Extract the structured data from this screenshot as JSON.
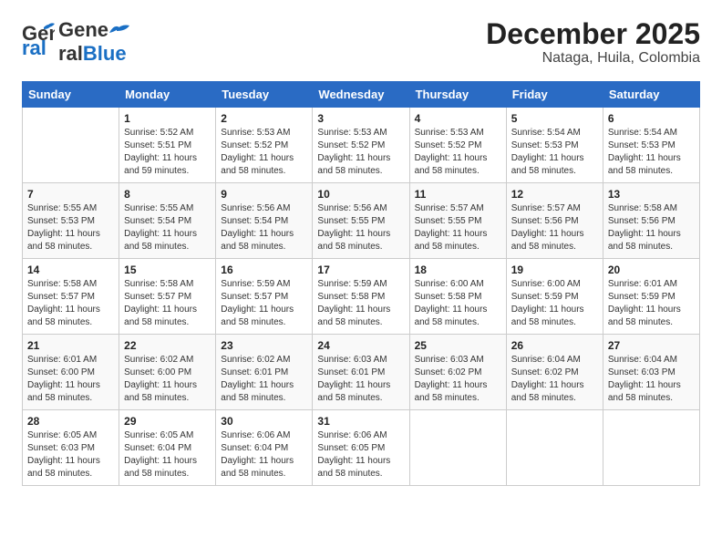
{
  "header": {
    "logo_general": "General",
    "logo_blue": "Blue",
    "title": "December 2025",
    "subtitle": "Nataga, Huila, Colombia"
  },
  "days_of_week": [
    "Sunday",
    "Monday",
    "Tuesday",
    "Wednesday",
    "Thursday",
    "Friday",
    "Saturday"
  ],
  "weeks": [
    [
      {
        "day": "",
        "sunrise": "",
        "sunset": "",
        "daylight": ""
      },
      {
        "day": "1",
        "sunrise": "Sunrise: 5:52 AM",
        "sunset": "Sunset: 5:51 PM",
        "daylight": "Daylight: 11 hours and 59 minutes."
      },
      {
        "day": "2",
        "sunrise": "Sunrise: 5:53 AM",
        "sunset": "Sunset: 5:52 PM",
        "daylight": "Daylight: 11 hours and 58 minutes."
      },
      {
        "day": "3",
        "sunrise": "Sunrise: 5:53 AM",
        "sunset": "Sunset: 5:52 PM",
        "daylight": "Daylight: 11 hours and 58 minutes."
      },
      {
        "day": "4",
        "sunrise": "Sunrise: 5:53 AM",
        "sunset": "Sunset: 5:52 PM",
        "daylight": "Daylight: 11 hours and 58 minutes."
      },
      {
        "day": "5",
        "sunrise": "Sunrise: 5:54 AM",
        "sunset": "Sunset: 5:53 PM",
        "daylight": "Daylight: 11 hours and 58 minutes."
      },
      {
        "day": "6",
        "sunrise": "Sunrise: 5:54 AM",
        "sunset": "Sunset: 5:53 PM",
        "daylight": "Daylight: 11 hours and 58 minutes."
      }
    ],
    [
      {
        "day": "7",
        "sunrise": "Sunrise: 5:55 AM",
        "sunset": "Sunset: 5:53 PM",
        "daylight": "Daylight: 11 hours and 58 minutes."
      },
      {
        "day": "8",
        "sunrise": "Sunrise: 5:55 AM",
        "sunset": "Sunset: 5:54 PM",
        "daylight": "Daylight: 11 hours and 58 minutes."
      },
      {
        "day": "9",
        "sunrise": "Sunrise: 5:56 AM",
        "sunset": "Sunset: 5:54 PM",
        "daylight": "Daylight: 11 hours and 58 minutes."
      },
      {
        "day": "10",
        "sunrise": "Sunrise: 5:56 AM",
        "sunset": "Sunset: 5:55 PM",
        "daylight": "Daylight: 11 hours and 58 minutes."
      },
      {
        "day": "11",
        "sunrise": "Sunrise: 5:57 AM",
        "sunset": "Sunset: 5:55 PM",
        "daylight": "Daylight: 11 hours and 58 minutes."
      },
      {
        "day": "12",
        "sunrise": "Sunrise: 5:57 AM",
        "sunset": "Sunset: 5:56 PM",
        "daylight": "Daylight: 11 hours and 58 minutes."
      },
      {
        "day": "13",
        "sunrise": "Sunrise: 5:58 AM",
        "sunset": "Sunset: 5:56 PM",
        "daylight": "Daylight: 11 hours and 58 minutes."
      }
    ],
    [
      {
        "day": "14",
        "sunrise": "Sunrise: 5:58 AM",
        "sunset": "Sunset: 5:57 PM",
        "daylight": "Daylight: 11 hours and 58 minutes."
      },
      {
        "day": "15",
        "sunrise": "Sunrise: 5:58 AM",
        "sunset": "Sunset: 5:57 PM",
        "daylight": "Daylight: 11 hours and 58 minutes."
      },
      {
        "day": "16",
        "sunrise": "Sunrise: 5:59 AM",
        "sunset": "Sunset: 5:57 PM",
        "daylight": "Daylight: 11 hours and 58 minutes."
      },
      {
        "day": "17",
        "sunrise": "Sunrise: 5:59 AM",
        "sunset": "Sunset: 5:58 PM",
        "daylight": "Daylight: 11 hours and 58 minutes."
      },
      {
        "day": "18",
        "sunrise": "Sunrise: 6:00 AM",
        "sunset": "Sunset: 5:58 PM",
        "daylight": "Daylight: 11 hours and 58 minutes."
      },
      {
        "day": "19",
        "sunrise": "Sunrise: 6:00 AM",
        "sunset": "Sunset: 5:59 PM",
        "daylight": "Daylight: 11 hours and 58 minutes."
      },
      {
        "day": "20",
        "sunrise": "Sunrise: 6:01 AM",
        "sunset": "Sunset: 5:59 PM",
        "daylight": "Daylight: 11 hours and 58 minutes."
      }
    ],
    [
      {
        "day": "21",
        "sunrise": "Sunrise: 6:01 AM",
        "sunset": "Sunset: 6:00 PM",
        "daylight": "Daylight: 11 hours and 58 minutes."
      },
      {
        "day": "22",
        "sunrise": "Sunrise: 6:02 AM",
        "sunset": "Sunset: 6:00 PM",
        "daylight": "Daylight: 11 hours and 58 minutes."
      },
      {
        "day": "23",
        "sunrise": "Sunrise: 6:02 AM",
        "sunset": "Sunset: 6:01 PM",
        "daylight": "Daylight: 11 hours and 58 minutes."
      },
      {
        "day": "24",
        "sunrise": "Sunrise: 6:03 AM",
        "sunset": "Sunset: 6:01 PM",
        "daylight": "Daylight: 11 hours and 58 minutes."
      },
      {
        "day": "25",
        "sunrise": "Sunrise: 6:03 AM",
        "sunset": "Sunset: 6:02 PM",
        "daylight": "Daylight: 11 hours and 58 minutes."
      },
      {
        "day": "26",
        "sunrise": "Sunrise: 6:04 AM",
        "sunset": "Sunset: 6:02 PM",
        "daylight": "Daylight: 11 hours and 58 minutes."
      },
      {
        "day": "27",
        "sunrise": "Sunrise: 6:04 AM",
        "sunset": "Sunset: 6:03 PM",
        "daylight": "Daylight: 11 hours and 58 minutes."
      }
    ],
    [
      {
        "day": "28",
        "sunrise": "Sunrise: 6:05 AM",
        "sunset": "Sunset: 6:03 PM",
        "daylight": "Daylight: 11 hours and 58 minutes."
      },
      {
        "day": "29",
        "sunrise": "Sunrise: 6:05 AM",
        "sunset": "Sunset: 6:04 PM",
        "daylight": "Daylight: 11 hours and 58 minutes."
      },
      {
        "day": "30",
        "sunrise": "Sunrise: 6:06 AM",
        "sunset": "Sunset: 6:04 PM",
        "daylight": "Daylight: 11 hours and 58 minutes."
      },
      {
        "day": "31",
        "sunrise": "Sunrise: 6:06 AM",
        "sunset": "Sunset: 6:05 PM",
        "daylight": "Daylight: 11 hours and 58 minutes."
      },
      {
        "day": "",
        "sunrise": "",
        "sunset": "",
        "daylight": ""
      },
      {
        "day": "",
        "sunrise": "",
        "sunset": "",
        "daylight": ""
      },
      {
        "day": "",
        "sunrise": "",
        "sunset": "",
        "daylight": ""
      }
    ]
  ]
}
